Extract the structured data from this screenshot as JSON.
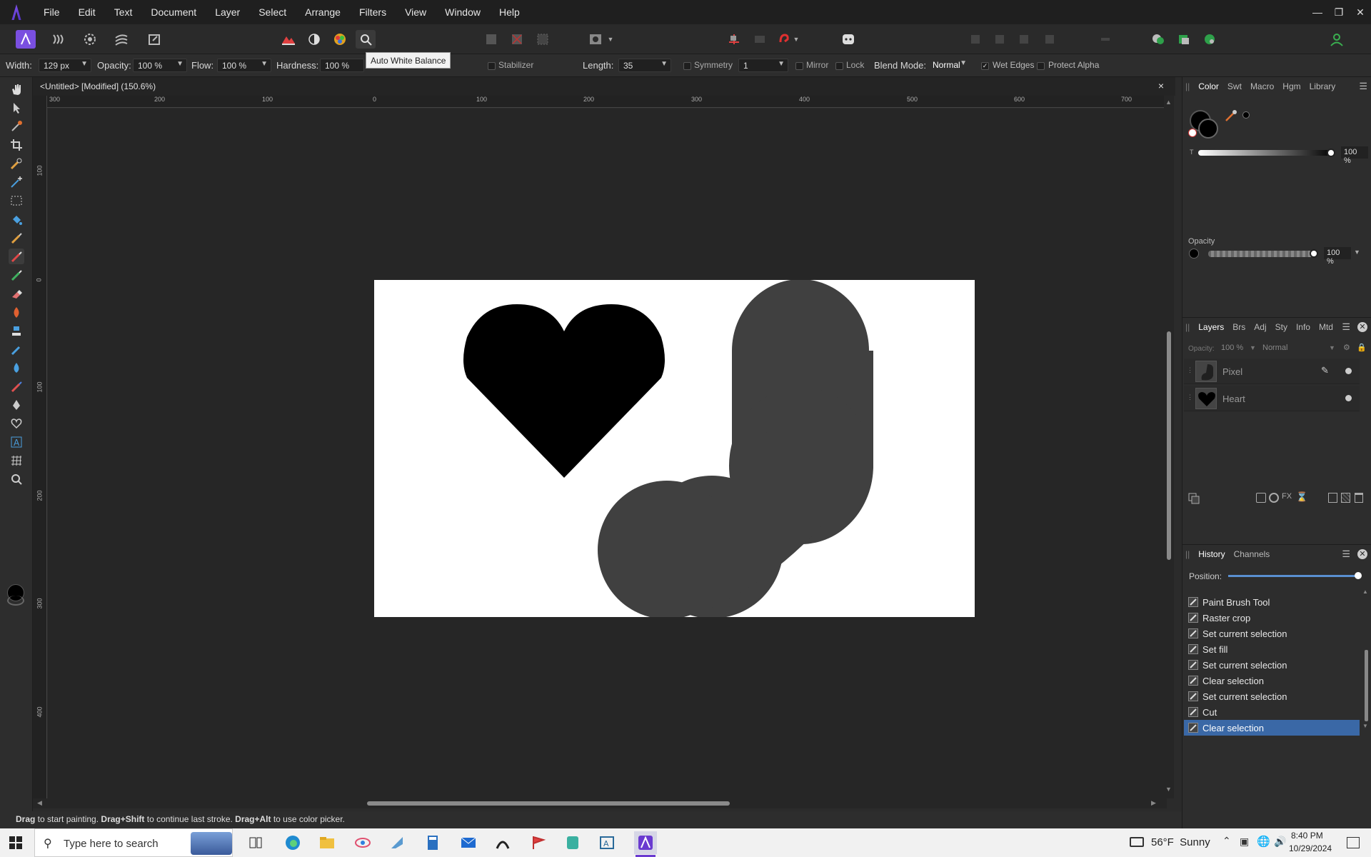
{
  "menu": {
    "items": [
      "File",
      "Edit",
      "Text",
      "Document",
      "Layer",
      "Select",
      "Arrange",
      "Filters",
      "View",
      "Window",
      "Help"
    ]
  },
  "tooltip": "Auto White Balance",
  "context": {
    "width_label": "Width:",
    "width_value": "129 px",
    "opacity_label": "Opacity:",
    "opacity_value": "100 %",
    "flow_label": "Flow:",
    "flow_value": "100 %",
    "hardness_label": "Hardness:",
    "hardness_value": "100 %",
    "stabilizer": "Stabilizer",
    "length_label": "Length:",
    "length_value": "35",
    "symmetry": "Symmetry",
    "symmetry_value": "1",
    "mirror": "Mirror",
    "lock": "Lock",
    "blend_label": "Blend Mode:",
    "blend_value": "Normal",
    "wet_edges": "Wet Edges",
    "protect_alpha": "Protect Alpha"
  },
  "document": {
    "title": "<Untitled> [Modified] (150.6%)",
    "close": "×"
  },
  "ruler": {
    "unit": "px",
    "h_ticks": [
      "300",
      "200",
      "100",
      "0",
      "100",
      "200",
      "300",
      "400",
      "500",
      "600",
      "700"
    ],
    "v_ticks": [
      "100",
      "0",
      "100",
      "200",
      "300",
      "400"
    ]
  },
  "status": {
    "p1": "Drag",
    "p2": " to start painting. ",
    "p3": "Drag+Shift",
    "p4": " to continue last stroke. ",
    "p5": "Drag+Alt",
    "p6": " to use color picker."
  },
  "color_panel": {
    "tabs": [
      "Color",
      "Swt",
      "Macro",
      "Hgm",
      "Library"
    ],
    "transparency_label": "T",
    "transparency_value": "100 %",
    "opacity_label": "Opacity",
    "opacity_value": "100 %"
  },
  "layers_panel": {
    "tabs": [
      "Layers",
      "Brs",
      "Adj",
      "Sty",
      "Info",
      "Mtd"
    ],
    "opacity_label": "Opacity:",
    "opacity_value": "100 %",
    "blend": "Normal",
    "layers": [
      {
        "name": "Pixel"
      },
      {
        "name": "Heart"
      }
    ]
  },
  "history_panel": {
    "tabs": [
      "History",
      "Channels"
    ],
    "position_label": "Position:",
    "items": [
      "Paint Brush Tool",
      "Raster crop",
      "Set current selection",
      "Set fill",
      "Set current selection",
      "Clear selection",
      "Set current selection",
      "Cut",
      "Clear selection"
    ],
    "selected_index": 8
  },
  "taskbar": {
    "search_placeholder": "Type here to search",
    "weather": "56°F  Sunny",
    "time": "8:40 PM",
    "date": "10/29/2024"
  },
  "colors": {
    "accent": "#3a68a6",
    "stroke_gray": "#404040",
    "primary_color": "#000000"
  }
}
